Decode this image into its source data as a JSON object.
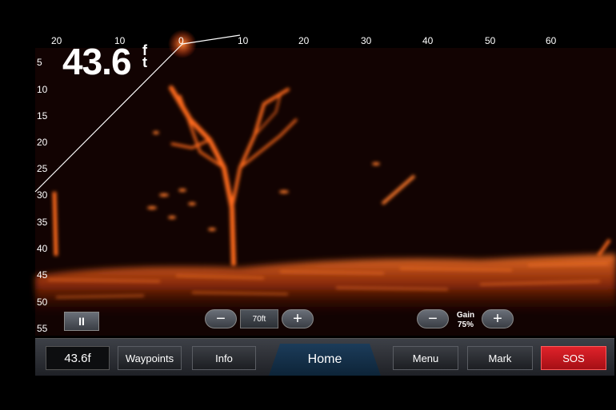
{
  "sonar": {
    "depth_value": "43.6",
    "depth_unit": "ft",
    "x_ticks_left": [
      "20",
      "10"
    ],
    "x_ticks_right": [
      "0",
      "10",
      "20",
      "30",
      "40",
      "50",
      "60"
    ],
    "y_ticks": [
      "5",
      "10",
      "15",
      "20",
      "25",
      "30",
      "35",
      "40",
      "45",
      "50",
      "55"
    ]
  },
  "controls": {
    "pause_label": "II",
    "range_minus": "−",
    "range_value": "70ft",
    "range_plus": "+",
    "gain_minus": "−",
    "gain_title": "Gain",
    "gain_value": "75%",
    "gain_plus": "+"
  },
  "bottombar": {
    "depth_readout": "43.6f",
    "waypoints": "Waypoints",
    "info": "Info",
    "home": "Home",
    "menu": "Menu",
    "mark": "Mark",
    "sos": "SOS"
  },
  "colors": {
    "sonar_return": "#ff6a1a",
    "sos": "#d91c24",
    "home_tab": "#173450"
  }
}
